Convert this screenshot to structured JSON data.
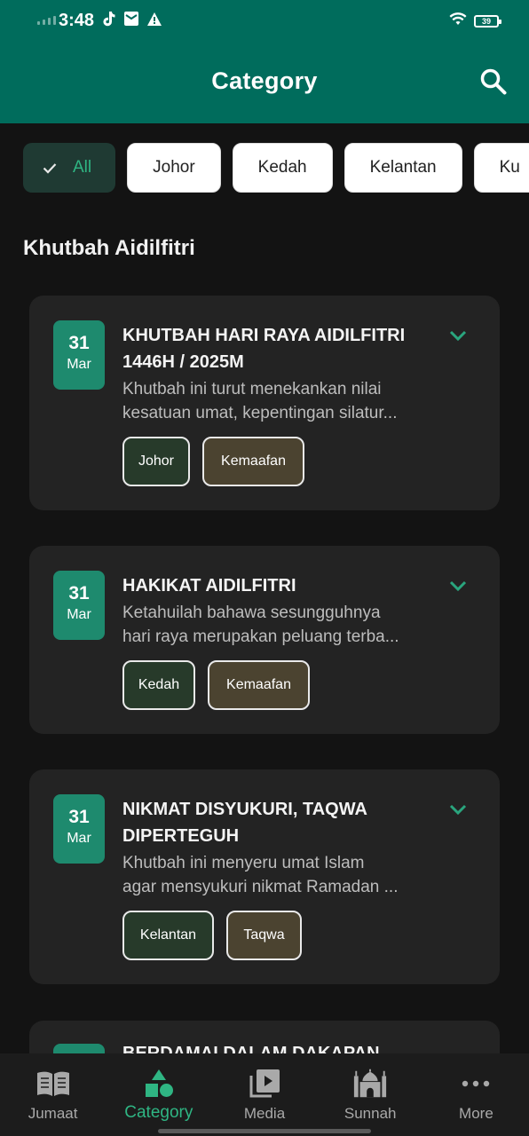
{
  "status_bar": {
    "time": "3:48",
    "battery": "39",
    "icons": [
      "signal-icon",
      "tiktok-icon",
      "mail-icon",
      "warning-icon",
      "wifi-icon",
      "battery-icon"
    ]
  },
  "header": {
    "title": "Category",
    "search_icon": "search-icon"
  },
  "chips": [
    {
      "label": "All",
      "selected": true
    },
    {
      "label": "Johor",
      "selected": false
    },
    {
      "label": "Kedah",
      "selected": false
    },
    {
      "label": "Kelantan",
      "selected": false
    },
    {
      "label": "Ku",
      "selected": false
    }
  ],
  "section_title": "Khutbah Aidilfitri",
  "cards": [
    {
      "day": "31",
      "month": "Mar",
      "title_lines": [
        "KHUTBAH HARI RAYA AIDILFITRI",
        "1446H / 2025M"
      ],
      "desc_lines": [
        "Khutbah ini turut menekankan nilai",
        "kesatuan umat, kepentingan silatur..."
      ],
      "tags": [
        "Johor",
        "Kemaafan"
      ]
    },
    {
      "day": "31",
      "month": "Mar",
      "title_lines": [
        "HAKIKAT AIDILFITRI"
      ],
      "desc_lines": [
        "Ketahuilah bahawa sesungguhnya",
        "hari raya merupakan peluang terba..."
      ],
      "tags": [
        "Kedah",
        "Kemaafan"
      ]
    },
    {
      "day": "31",
      "month": "Mar",
      "title_lines": [
        "NIKMAT DISYUKURI, TAQWA",
        "DIPERTEGUH"
      ],
      "desc_lines": [
        "Khutbah ini menyeru umat Islam",
        "agar mensyukuri nikmat Ramadan ..."
      ],
      "tags": [
        "Kelantan",
        "Taqwa"
      ]
    },
    {
      "title_lines": [
        "BERDAMAI DALAM DAKAPAN"
      ]
    }
  ],
  "bottom_nav": [
    {
      "label": "Jumaat",
      "icon": "book-icon",
      "active": false
    },
    {
      "label": "Category",
      "icon": "shapes-icon",
      "active": true
    },
    {
      "label": "Media",
      "icon": "video-library-icon",
      "active": false
    },
    {
      "label": "Sunnah",
      "icon": "mosque-icon",
      "active": false
    },
    {
      "label": "More",
      "icon": "more-dots-icon",
      "active": false
    }
  ],
  "colors": {
    "header_bg": "#006c5c",
    "accent": "#2fb583",
    "date_badge": "#1e8a6e",
    "background": "#131313",
    "card_bg": "#232323"
  }
}
